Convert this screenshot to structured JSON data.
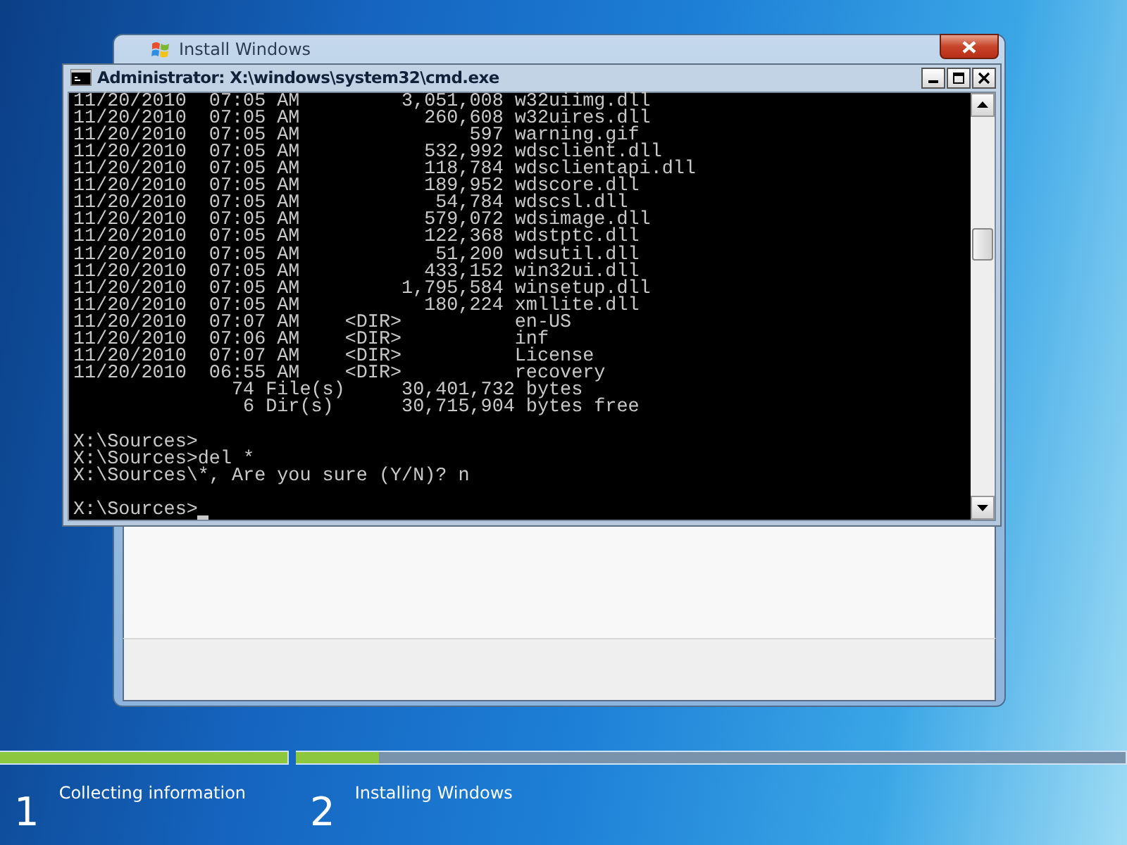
{
  "setup_window": {
    "title": "Install Windows"
  },
  "console_window": {
    "title": "Administrator: X:\\windows\\system32\\cmd.exe",
    "blocks": [
      [
        "11/20/2010  07:05 AM         3,051,008 w32uiimg.dll",
        "11/20/2010  07:05 AM           260,608 w32uires.dll",
        "11/20/2010  07:05 AM               597 warning.gif",
        "11/20/2010  07:05 AM           532,992 wdsclient.dll",
        "11/20/2010  07:05 AM           118,784 wdsclientapi.dll",
        "11/20/2010  07:05 AM           189,952 wdscore.dll",
        "11/20/2010  07:05 AM            54,784 wdscsl.dll",
        "11/20/2010  07:05 AM           579,072 wdsimage.dll",
        "11/20/2010  07:05 AM           122,368 wdstptc.dll",
        "11/20/2010  07:05 AM            51,200 wdsutil.dll",
        "11/20/2010  07:05 AM           433,152 win32ui.dll",
        "11/20/2010  07:05 AM         1,795,584 winsetup.dll",
        "11/20/2010  07:05 AM           180,224 xmllite.dll",
        "11/20/2010  07:07 AM    <DIR>          en-US",
        "11/20/2010  07:06 AM    <DIR>          inf",
        "11/20/2010  07:07 AM    <DIR>          License",
        "11/20/2010  06:55 AM    <DIR>          recovery",
        "              74 File(s)     30,401,732 bytes",
        "               6 Dir(s)      30,715,904 bytes free"
      ],
      [
        "X:\\Sources>",
        "X:\\Sources>del *",
        "X:\\Sources\\*, Are you sure (Y/N)? n"
      ]
    ],
    "prompt": "X:\\Sources>"
  },
  "steps": [
    {
      "number": "1",
      "label": "Collecting information",
      "level": 1
    },
    {
      "number": "2",
      "label": "Installing Windows",
      "level": 0.1
    }
  ]
}
